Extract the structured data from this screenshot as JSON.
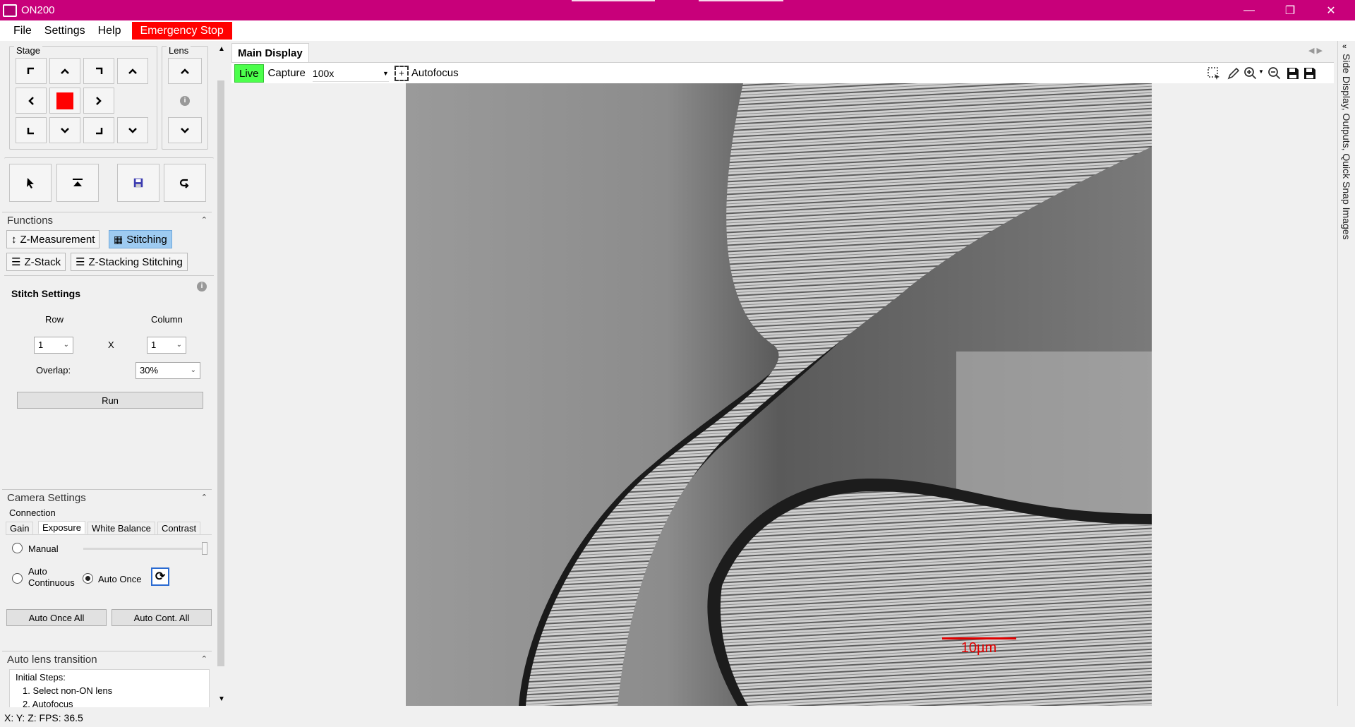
{
  "window": {
    "title": "ON200"
  },
  "menu": {
    "file": "File",
    "settings": "Settings",
    "help": "Help",
    "emergency_stop": "Emergency Stop"
  },
  "stage": {
    "label": "Stage",
    "lens_label": "Lens"
  },
  "functions": {
    "header": "Functions",
    "buttons": [
      "Z-Measurement",
      "Stitching",
      "Z-Stack",
      "Z-Stacking Stitching"
    ],
    "active": "Stitching"
  },
  "stitch": {
    "title": "Stitch Settings",
    "row_label": "Row",
    "column_label": "Column",
    "row_value": "1",
    "x_label": "X",
    "column_value": "1",
    "overlap_label": "Overlap:",
    "overlap_value": "30%",
    "run_label": "Run"
  },
  "camera": {
    "header": "Camera Settings",
    "connection": "Connection",
    "tabs": [
      "Gain",
      "Exposure",
      "White Balance",
      "Contrast"
    ],
    "active_tab": "Exposure",
    "manual_label": "Manual",
    "auto_continuous_line1": "Auto",
    "auto_continuous_line2": "Continuous",
    "auto_once_label": "Auto Once",
    "selected_mode": "Auto Once",
    "auto_once_all": "Auto Once All",
    "auto_cont_all": "Auto Cont. All"
  },
  "auto_lens": {
    "header": "Auto lens transition",
    "initial_steps": "Initial Steps:",
    "steps": [
      "1. Select non-ON lens",
      "2. Autofocus"
    ]
  },
  "display": {
    "tab": "Main Display",
    "live": "Live",
    "capture": "Capture",
    "magnification": "100x",
    "autofocus": "Autofocus",
    "scale_bar": "10µm"
  },
  "sidebar": {
    "label": "Side Display, Outputs, Quick Snap Images"
  },
  "status": {
    "text": "X:  Y:  Z:  FPS:   36.5"
  },
  "colors": {
    "titlebar": "#c8007a",
    "estop": "#ff0000",
    "live": "#4cff4c",
    "active_fn": "#9ecbf1"
  }
}
